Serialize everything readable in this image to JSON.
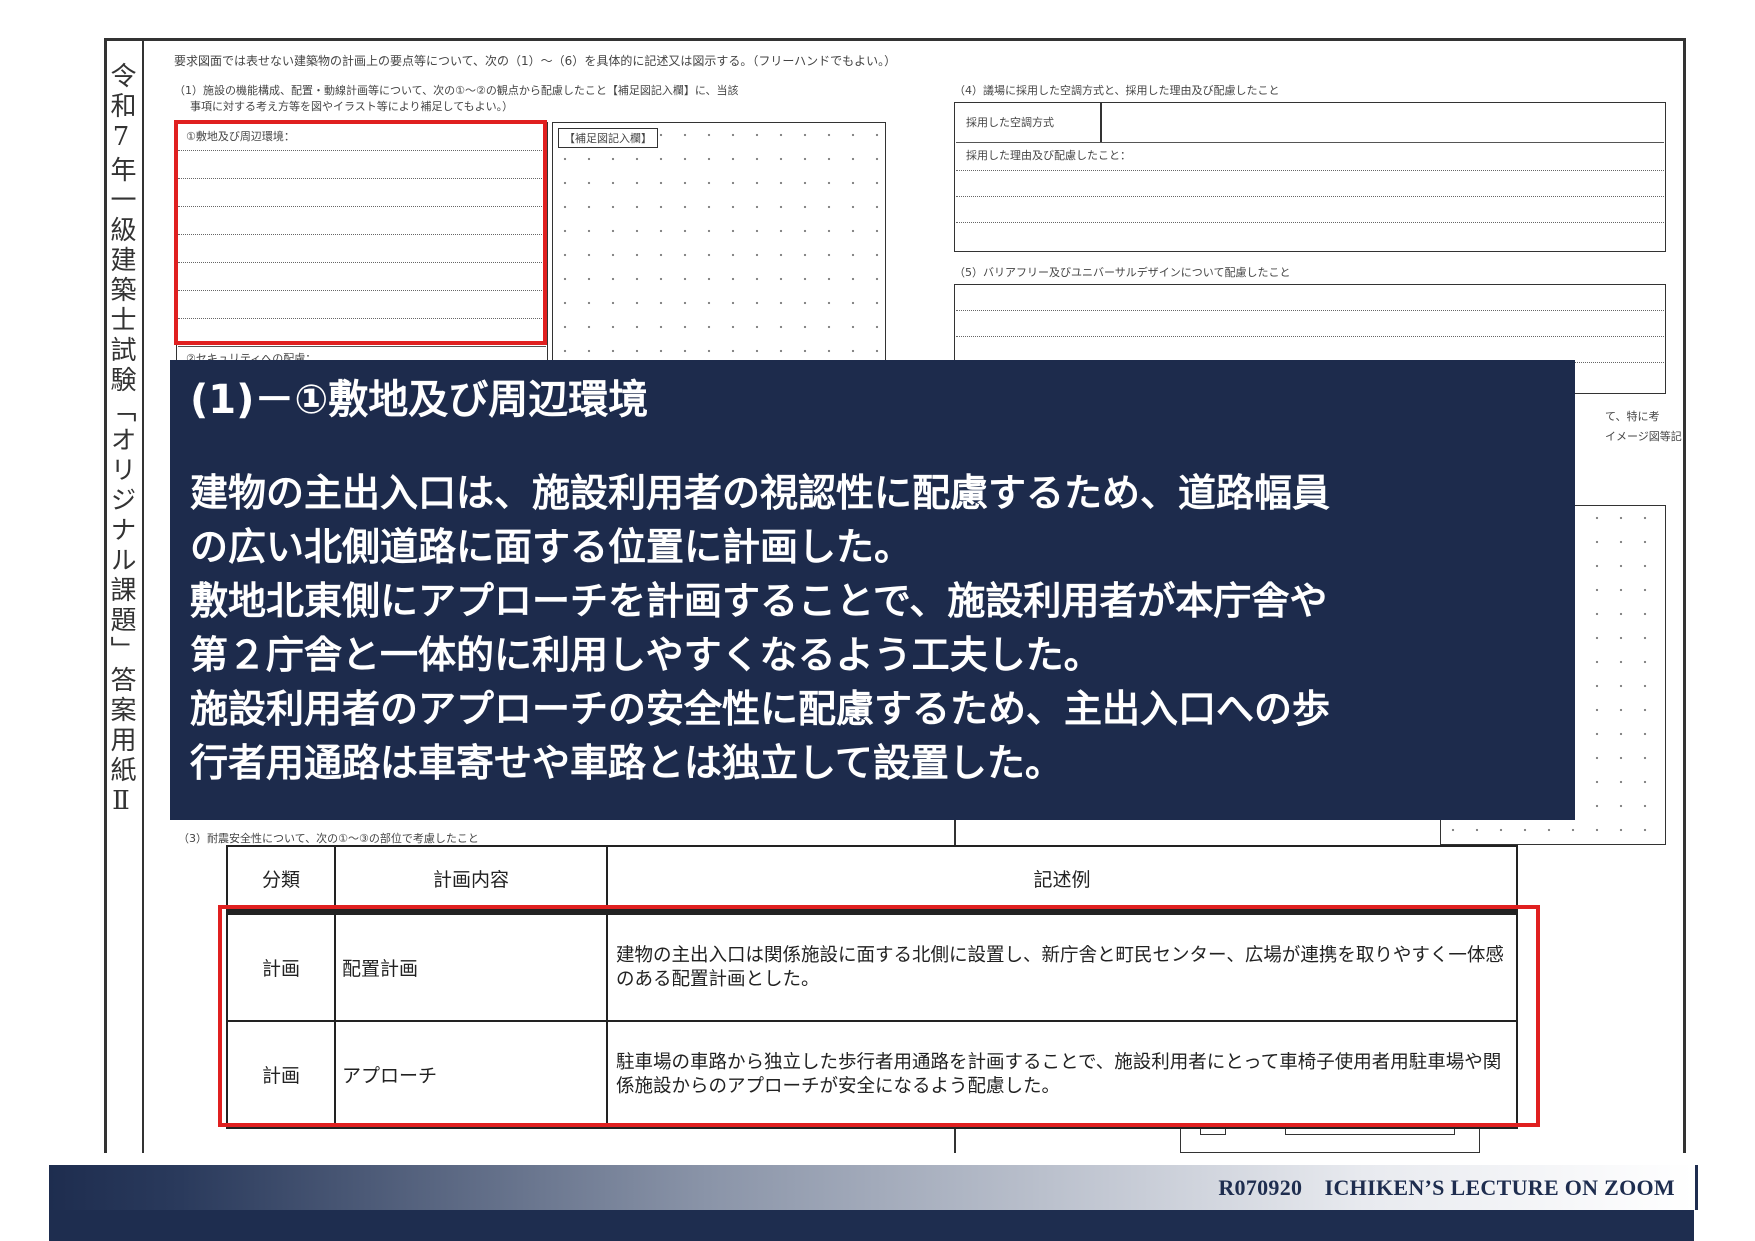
{
  "sheet": {
    "vertical_title": "令和7年一級建築士試験「オリジナル課題」答案用紙Ⅱ",
    "instruction": "要求図面では表せない建築物の計画上の要点等について、次の（1）～（6）を具体的に記述又は図示する。（フリーハンドでもよい。）",
    "q1": {
      "text_line1": "（1）施設の機能構成、配置・動線計画等について、次の①～②の観点から配慮したこと【補足図記入欄】に、当該",
      "text_line2": "事項に対する考え方等を図やイラスト等により補足してもよい。）",
      "item1": "①敷地及び周辺環境：",
      "item2": "②セキュリティへの配慮：",
      "supplement_label": "【補足図記入欄】"
    },
    "q3": {
      "text": "（3）耐震安全性について、次の①～③の部位で考慮したこと"
    },
    "q4": {
      "text": "（4）議場に採用した空調方式と、採用した理由及び配慮したこと",
      "row1": "採用した空調方式",
      "row2": "採用した理由及び配慮したこと："
    },
    "q5": {
      "text": "（5）バリアフリー及びユニバーサルデザインについて配慮したこと"
    },
    "q6": {
      "text_line1": "て、特に考",
      "text_line2": "イメージ図等記"
    }
  },
  "overlay": {
    "heading": "(1)－①敷地及び周辺環境",
    "lines": [
      "建物の主出入口は、施設利用者の視認性に配慮するため、道路幅員",
      "の広い北側道路に面する位置に計画した。",
      "敷地北東側にアプローチを計画することで、施設利用者が本庁舎や",
      "第２庁舎と一体的に利用しやすくなるよう工夫した。",
      "施設利用者のアプローチの安全性に配慮するため、主出入口への歩",
      "行者用通路は車寄せや車路とは独立して設置した。"
    ]
  },
  "table": {
    "headers": [
      "分類",
      "計画内容",
      "記述例"
    ],
    "rows": [
      {
        "category": "計画",
        "content": "配置計画",
        "example": "建物の主出入口は関係施設に面する北側に設置し、新庁舎と町民センター、広場が連携を取りやすく一体感のある配置計画とした。"
      },
      {
        "category": "計画",
        "content": "アプローチ",
        "example": "駐車場の車路から独立した歩行者用通路を計画することで、施設利用者にとって車椅子使用者用駐車場や関係施設からのアプローチが安全になるよう配慮した。"
      }
    ]
  },
  "footer": {
    "text": "R070920　ICHIKEN’S LECTURE ON ZOOM"
  },
  "colors": {
    "overlay_bg": "#1d2b4c",
    "highlight": "#e02020",
    "footer": "#1e2d4f"
  }
}
